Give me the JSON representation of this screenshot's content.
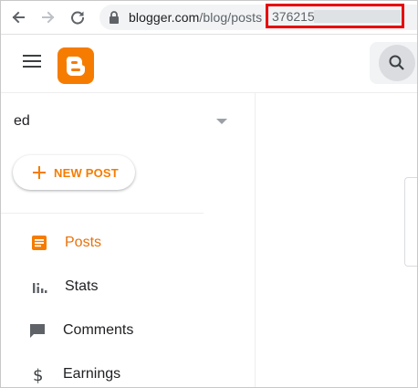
{
  "browser": {
    "url_host": "blogger.com",
    "url_path": "/blog/posts",
    "url_id_visible": "376215"
  },
  "header": {
    "menu_icon": "hamburger-menu-icon",
    "logo_icon": "blogger-logo-icon",
    "search_icon": "search-icon"
  },
  "sidebar": {
    "blog_name": "ed",
    "new_post_label": "NEW POST",
    "items": [
      {
        "label": "Posts",
        "icon": "posts-icon",
        "active": true
      },
      {
        "label": "Stats",
        "icon": "stats-icon",
        "active": false
      },
      {
        "label": "Comments",
        "icon": "comments-icon",
        "active": false
      },
      {
        "label": "Earnings",
        "icon": "earnings-icon",
        "active": false
      }
    ]
  },
  "colors": {
    "accent": "#f57c00",
    "active_text": "#e8710a",
    "highlight_border": "#e8000b"
  }
}
